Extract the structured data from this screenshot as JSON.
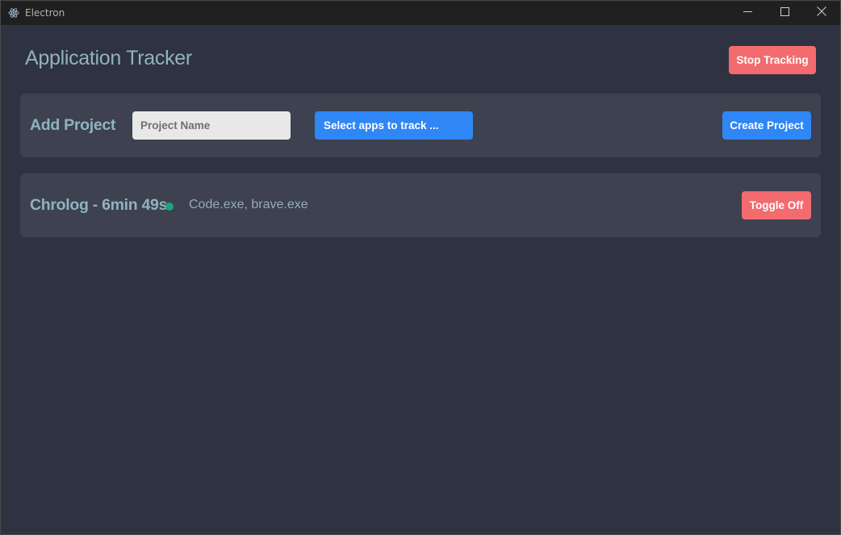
{
  "window": {
    "title": "Electron",
    "controls": {
      "minimize": "minimize-icon",
      "maximize": "maximize-icon",
      "close": "close-icon"
    }
  },
  "header": {
    "title": "Application Tracker",
    "stop_label": "Stop Tracking"
  },
  "add_project": {
    "title": "Add Project",
    "name_input": {
      "value": "",
      "placeholder": "Project Name"
    },
    "select_apps_label": "Select apps to track ...",
    "create_label": "Create Project"
  },
  "projects": [
    {
      "name": "Chrolog - 6min 49s",
      "status": "active",
      "apps": "Code.exe, brave.exe",
      "toggle_label": "Toggle Off"
    }
  ],
  "colors": {
    "background": "#2f3241",
    "panel": "#3d4150",
    "accent_text": "#8fb3bf",
    "primary": "#2f86f5",
    "danger": "#f26b6f",
    "status_active": "#1fa37a"
  }
}
